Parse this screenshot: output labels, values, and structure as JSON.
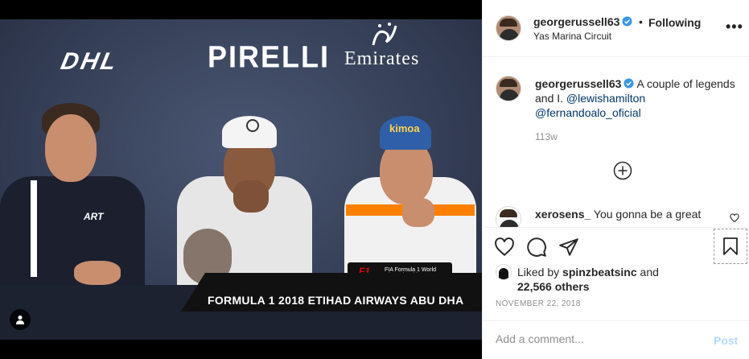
{
  "photo": {
    "sponsors": [
      "DHL",
      "PIRELLI",
      "Emirates"
    ],
    "banner_text": "FORMULA 1 2018 ETIHAD AIRWAYS ABU DHA",
    "f1_mark": "F1",
    "f1_small": "FIA Formula 1 World Championship"
  },
  "header": {
    "username": "georgerussell63",
    "separator": "•",
    "follow_label": "Following",
    "location": "Yas Marina Circuit",
    "more_label": "•••"
  },
  "caption": {
    "username": "georgerussell63",
    "text": "A couple of legends and I.",
    "mentions": [
      "@lewishamilton",
      "@fernandoalo_oficial"
    ],
    "time_ago": "113w"
  },
  "comment": {
    "username": "xerosens_",
    "text": "You gonna be a great"
  },
  "likes": {
    "prefix": "Liked by",
    "user": "spinzbeatsinc",
    "and": "and",
    "count": "22,566 others"
  },
  "date": "NOVEMBER 22, 2018",
  "add_comment": {
    "placeholder": "Add a comment...",
    "post_label": "Post"
  },
  "colors": {
    "verified": "#3897f0",
    "link": "#00376b",
    "post_disabled": "#b3dbff"
  }
}
